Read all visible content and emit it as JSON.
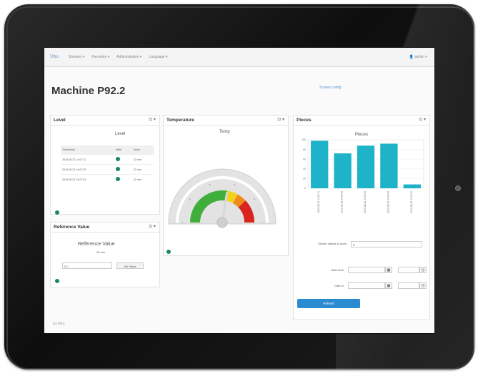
{
  "nav": {
    "brand": "Vau",
    "menu": [
      "Streams ▾",
      "Favorites ▾",
      "Administration ▾",
      "Language ▾"
    ],
    "user": "admin ▾"
  },
  "page": {
    "title": "Machine P92.2",
    "edit_link": "Screen config"
  },
  "level_panel": {
    "title": "Level",
    "tools": "⊡ ▾",
    "chart_title": "Level",
    "columns": [
      "Timestamp",
      "State",
      "Value"
    ],
    "rows": [
      {
        "timestamp": "2013-08-22 14:07:11",
        "value": "22 mm"
      },
      {
        "timestamp": "2013-08-22 14:07:02",
        "value": "22 mm"
      },
      {
        "timestamp": "2013-08-22 14:07:01",
        "value": "22 mm"
      }
    ]
  },
  "reference_panel": {
    "title": "Reference Value",
    "tools": "⊡ ▾",
    "heading": "Reference Value",
    "value": "90 mm",
    "input_value": "0.0",
    "button": "Set Value"
  },
  "temperature_panel": {
    "title": "Temperature",
    "tools": "⊡ ▾",
    "gauge_label": "Temp",
    "gauge_value": 0.55,
    "colors": {
      "green": "#3fae3a",
      "yellow": "#f2d21b",
      "orange": "#f08a1c",
      "red": "#d9251d"
    }
  },
  "pieces_panel": {
    "title": "Pieces",
    "tools": "⊡ ▾",
    "shown_values_label": "Shown Values (Count)",
    "shown_values": "5",
    "date_from_label": "Date from",
    "date_to_label": "Date to",
    "refresh": "Refresh",
    "bar_color": "#1fb3c9"
  },
  "chart_data": {
    "type": "bar",
    "title": "Pieces",
    "categories": [
      "2013-08-22 14:07:11",
      "2013-08-22 14:07:05",
      "2013-08-22 14:07:03",
      "2013-08-22 14:07:02",
      "2013-08-22 14:07:01"
    ],
    "values": [
      98,
      72,
      88,
      92,
      8
    ],
    "ylim": [
      0,
      100
    ],
    "yticks": [
      0,
      20,
      40,
      60,
      80,
      100
    ]
  },
  "footer": "(c) 2013"
}
